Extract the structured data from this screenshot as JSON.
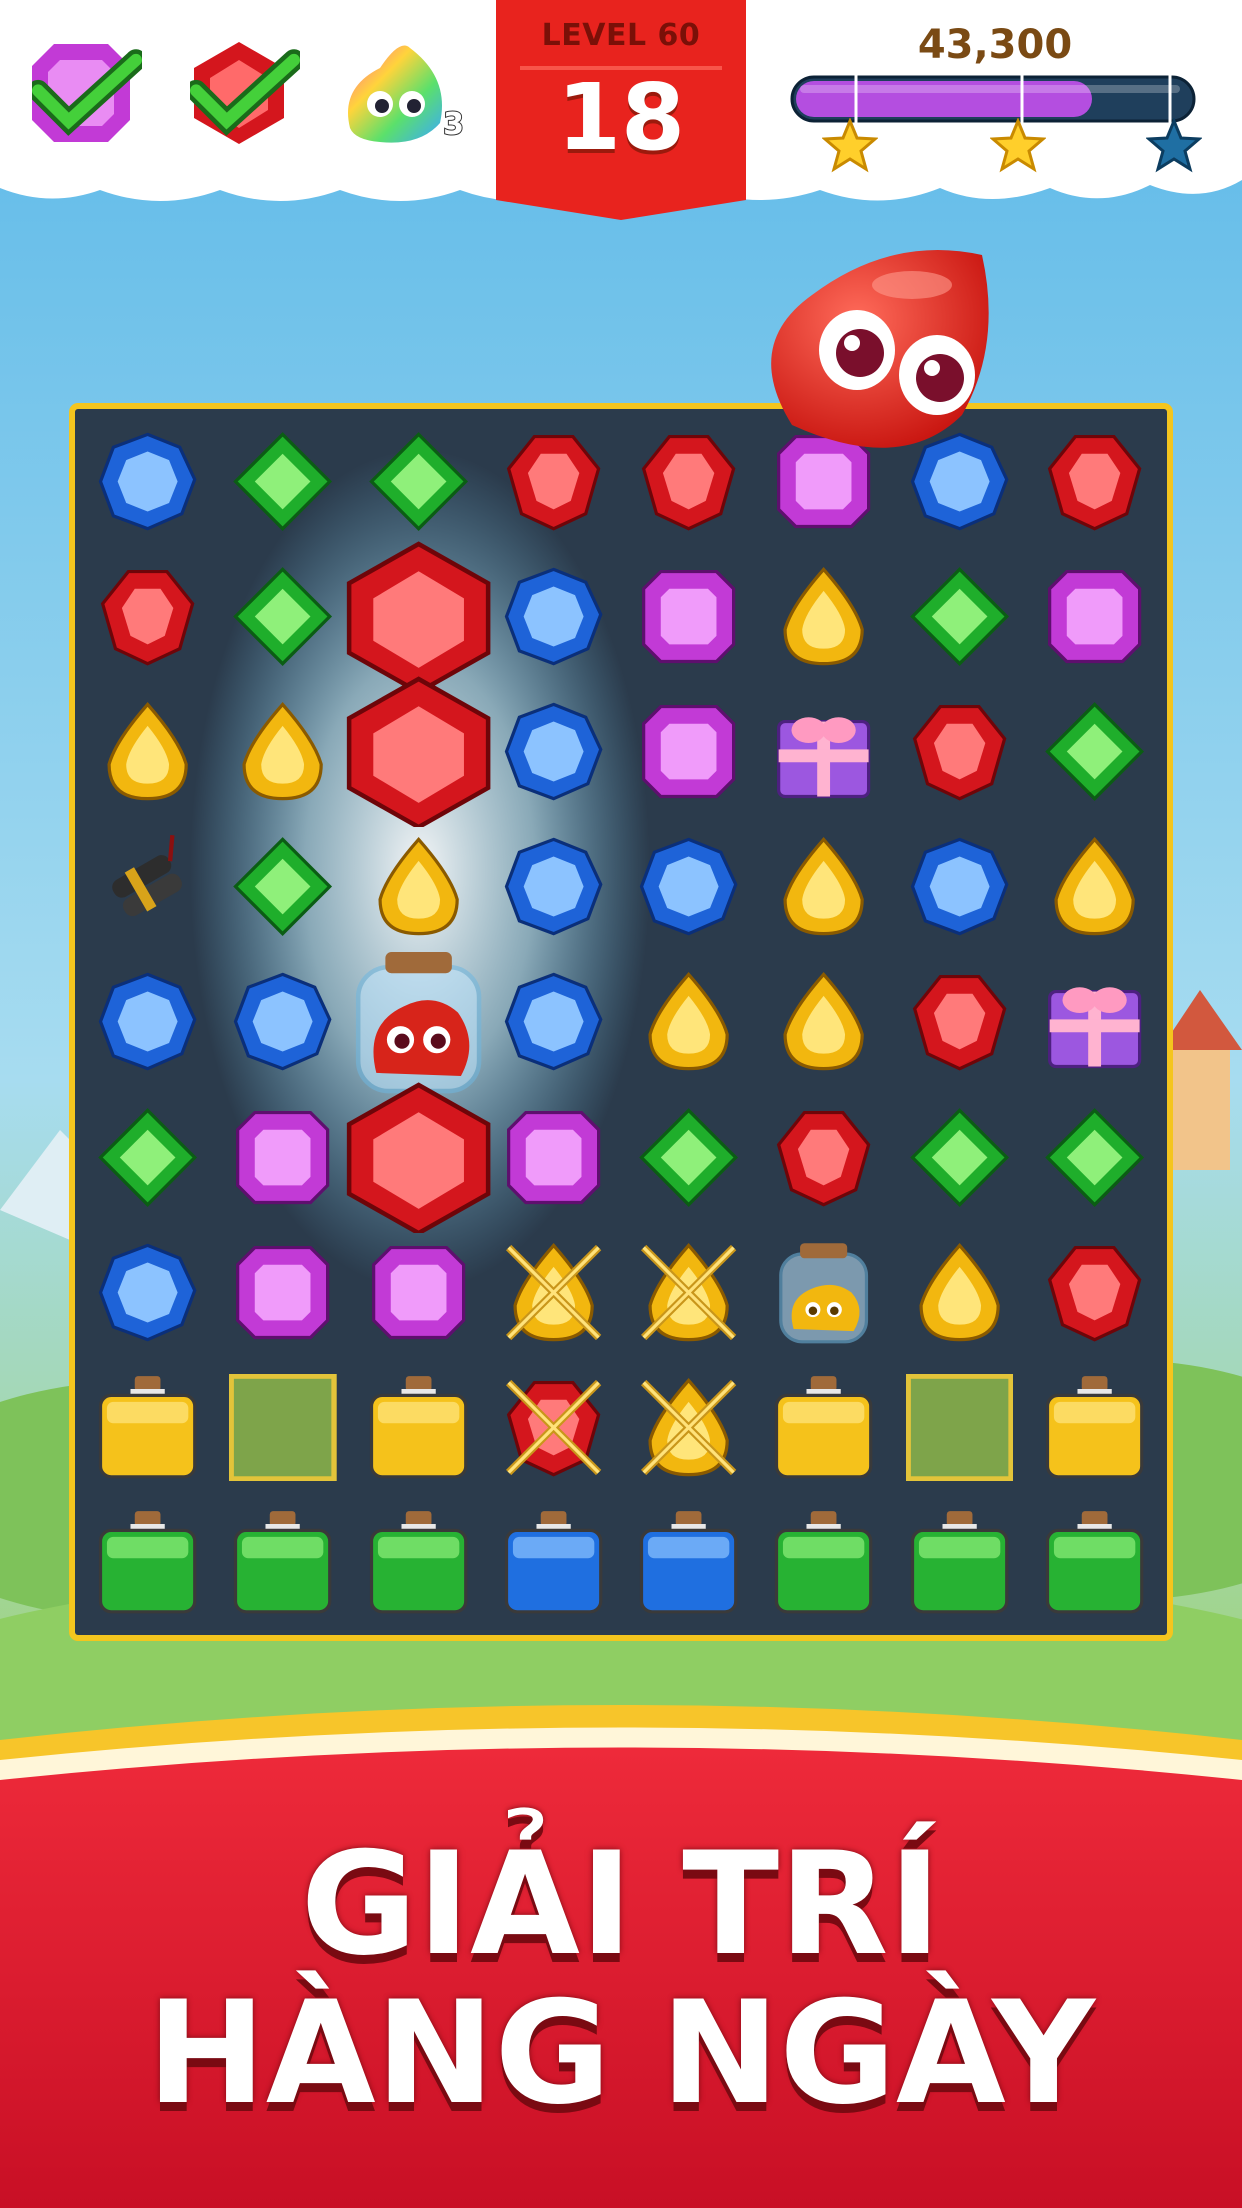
{
  "hud": {
    "goals": [
      {
        "icon": "purple-square-gem-icon",
        "status": "complete"
      },
      {
        "icon": "red-hexagon-gem-icon",
        "status": "complete"
      },
      {
        "icon": "rainbow-jelly-icon",
        "remaining": "3"
      }
    ],
    "level_label": "LEVEL 60",
    "moves_left": "18",
    "score": "43,300",
    "progress_fraction": 0.75,
    "stars": [
      {
        "icon": "gold-star-icon",
        "earned": true
      },
      {
        "icon": "gold-star-icon",
        "earned": true
      },
      {
        "icon": "blue-star-icon",
        "earned": false
      }
    ]
  },
  "board": {
    "columns": 8,
    "rows": 9,
    "cells": [
      [
        "blue-gem",
        "green-gem",
        "green-gem",
        "red-gem",
        "red-gem",
        "purple-gem",
        "blue-gem",
        "red-gem"
      ],
      [
        "red-gem",
        "green-gem",
        "red-hex-gem",
        "blue-gem",
        "purple-gem",
        "yellow-gem",
        "green-gem",
        "purple-gem"
      ],
      [
        "yellow-gem",
        "yellow-gem",
        "red-hex-gem",
        "blue-gem",
        "purple-gem",
        "gift-box",
        "red-gem",
        "green-gem"
      ],
      [
        "dynamite",
        "green-gem",
        "yellow-gem",
        "blue-gem",
        "blue-gem",
        "yellow-gem",
        "blue-gem",
        "yellow-gem"
      ],
      [
        "blue-gem",
        "blue-gem",
        "jelly-jar-red",
        "blue-gem",
        "yellow-gem",
        "yellow-gem",
        "red-gem",
        "gift-box"
      ],
      [
        "green-gem",
        "purple-gem",
        "red-hex-gem",
        "purple-gem",
        "green-gem",
        "red-gem",
        "green-gem",
        "green-gem"
      ],
      [
        "blue-gem",
        "purple-gem",
        "purple-gem",
        "chained-yellow-gem",
        "chained-yellow-gem",
        "jelly-jar-yellow",
        "yellow-gem",
        "red-gem"
      ],
      [
        "yellow-potion",
        "empty-slot",
        "yellow-potion",
        "chained-red-gem",
        "chained-yellow-gem",
        "yellow-potion",
        "empty-slot",
        "yellow-potion"
      ],
      [
        "green-potion",
        "green-potion",
        "green-potion",
        "blue-potion",
        "blue-potion",
        "green-potion",
        "green-potion",
        "green-potion"
      ]
    ]
  },
  "flying_piece": {
    "icon": "red-jelly-creature-icon"
  },
  "slogan": {
    "line1": "GIẢI TRÍ",
    "line2": "HÀNG NGÀY"
  },
  "colors": {
    "accent_red": "#e8231e",
    "banner_red": "#d9122b",
    "gold_border": "#f4c51e",
    "progress_fill": "#b44ee0",
    "board_bg": "#2b3b4c"
  }
}
